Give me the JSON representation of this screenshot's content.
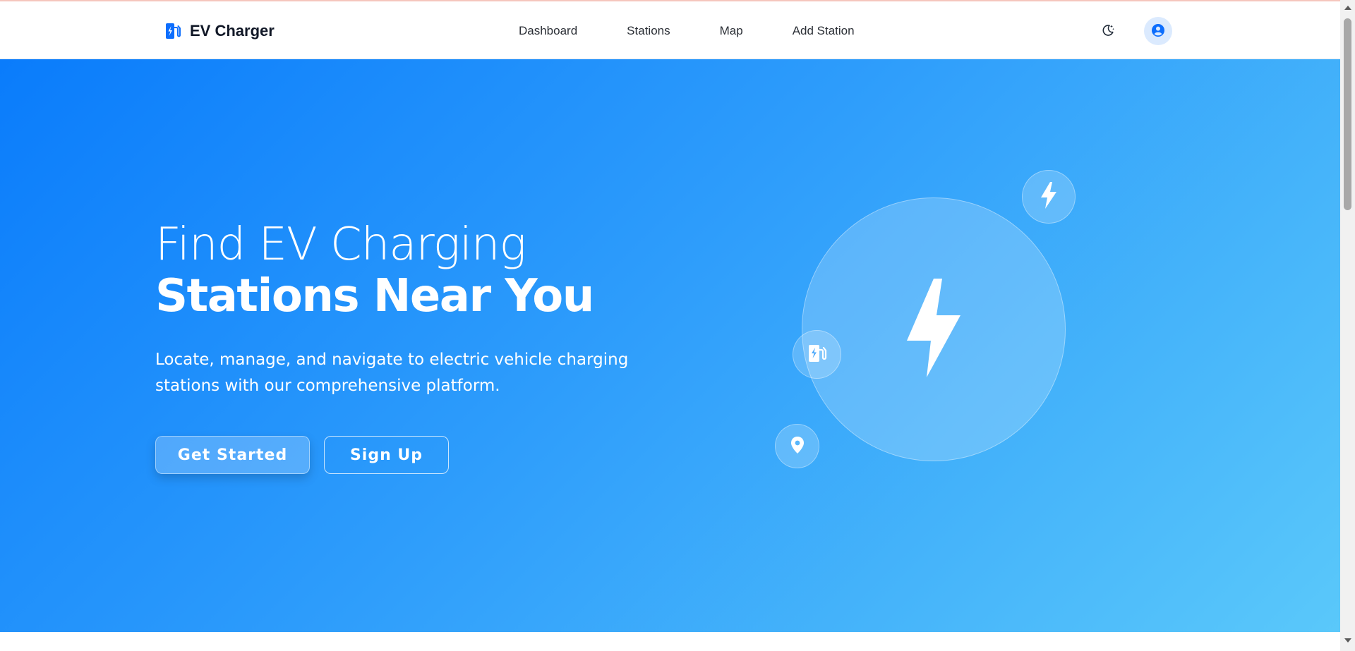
{
  "brand": {
    "name": "EV Charger",
    "icon": "ev-station-icon",
    "accent_color": "#0d6efd"
  },
  "nav": {
    "items": [
      {
        "label": "Dashboard"
      },
      {
        "label": "Stations"
      },
      {
        "label": "Map"
      },
      {
        "label": "Add Station"
      }
    ],
    "theme_toggle_icon": "moon-stars-icon",
    "profile_icon": "user-circle-icon"
  },
  "hero": {
    "title_light": "Find EV Charging",
    "title_bold": "Stations Near You",
    "subtitle": "Locate, manage, and navigate to electric vehicle charging stations with our comprehensive platform.",
    "primary_button": "Get Started",
    "secondary_button": "Sign Up",
    "gradient_colors": [
      "#0a7cfb",
      "#5ac8fa"
    ],
    "illustration_icons": [
      "lightning-icon",
      "ev-station-icon",
      "location-pin-icon"
    ]
  }
}
